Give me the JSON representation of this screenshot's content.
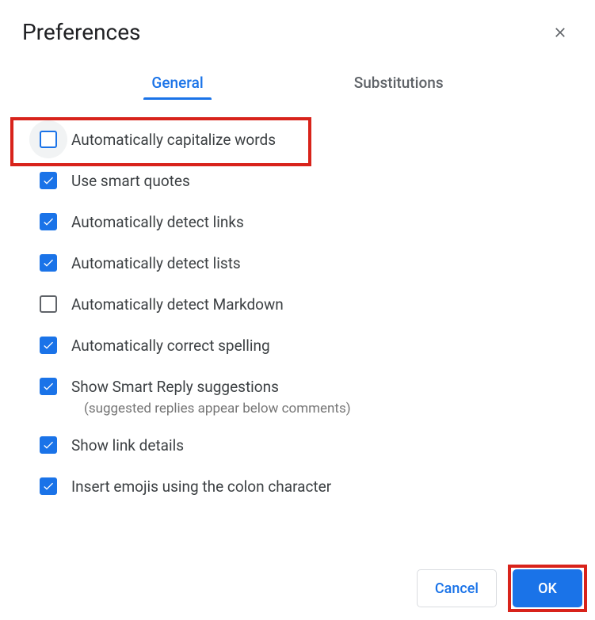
{
  "dialog": {
    "title": "Preferences"
  },
  "tabs": {
    "general": "General",
    "substitutions": "Substitutions"
  },
  "options": [
    {
      "key": "auto-capitalize",
      "label": "Automatically capitalize words",
      "checked": false,
      "highlighted": true,
      "focused": true
    },
    {
      "key": "smart-quotes",
      "label": "Use smart quotes",
      "checked": true
    },
    {
      "key": "detect-links",
      "label": "Automatically detect links",
      "checked": true
    },
    {
      "key": "detect-lists",
      "label": "Automatically detect lists",
      "checked": true
    },
    {
      "key": "detect-markdown",
      "label": "Automatically detect Markdown",
      "checked": false
    },
    {
      "key": "correct-spelling",
      "label": "Automatically correct spelling",
      "checked": true
    },
    {
      "key": "smart-reply",
      "label": "Show Smart Reply suggestions",
      "checked": true,
      "sublabel": "(suggested replies appear below comments)"
    },
    {
      "key": "link-details",
      "label": "Show link details",
      "checked": true
    },
    {
      "key": "emoji-colon",
      "label": "Insert emojis using the colon character",
      "checked": true
    }
  ],
  "footer": {
    "cancel": "Cancel",
    "ok": "OK"
  }
}
